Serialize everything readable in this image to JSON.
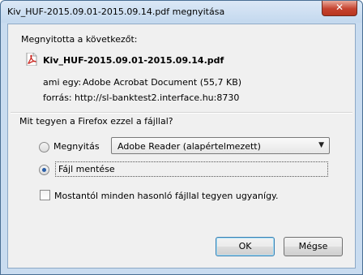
{
  "window": {
    "title": "Kiv_HUF-2015.09.01-2015.09.14.pdf megnyitása",
    "close_glyph": "✕"
  },
  "info": {
    "intro": "Megnyitotta a következőt:",
    "file_icon": "pdf-file-icon",
    "filename": "Kiv_HUF-2015.09.01-2015.09.14.pdf",
    "type_label": "ami egy:",
    "type_value": "Adobe Acrobat Document (55,7 KB)",
    "source_label": "forrás:",
    "source_value": "http://sl-banktest2.interface.hu:8730"
  },
  "action": {
    "question": "Mit tegyen a Firefox ezzel a fájllal?",
    "open_with_label": "Megnyitás",
    "open_with_app": "Adobe Reader  (alapértelmezett)",
    "save_label": "Fájl mentése",
    "selected": "save",
    "remember_label": "Mostantól minden hasonló fájllal tegyen ugyanígy.",
    "remember_checked": false
  },
  "buttons": {
    "ok": "OK",
    "cancel": "Mégse"
  }
}
